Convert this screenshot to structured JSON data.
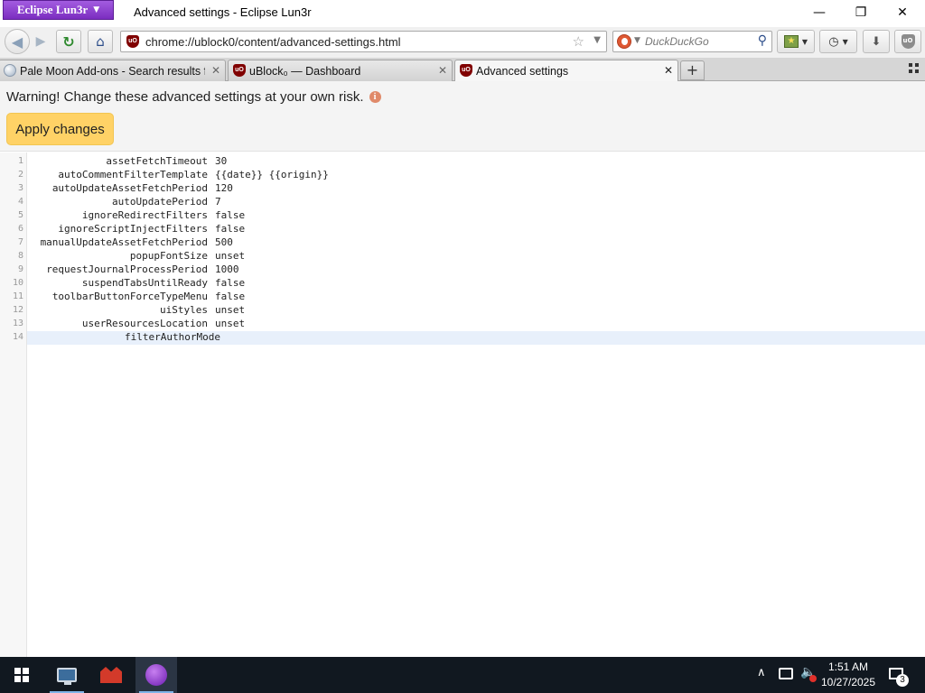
{
  "window": {
    "app_menu_label": "Eclipse Lun3r",
    "title": "Advanced settings - Eclipse Lun3r",
    "controls": [
      "—",
      "❐",
      "✕"
    ]
  },
  "navbar": {
    "url": "chrome://ublock0/content/advanced-settings.html",
    "search_placeholder": "DuckDuckGo"
  },
  "tabs": [
    {
      "label": "Pale Moon Add-ons - Search results for",
      "icon": "moon-icon",
      "active": false
    },
    {
      "label": "uBlock₀ — Dashboard",
      "icon": "ublock-icon",
      "active": false
    },
    {
      "label": "Advanced settings",
      "icon": "ublock-icon",
      "active": true
    }
  ],
  "page": {
    "warning": "Warning! Change these advanced settings at your own risk.",
    "apply_label": "Apply changes",
    "settings": [
      {
        "line": "1",
        "key": "assetFetchTimeout",
        "value": "30"
      },
      {
        "line": "2",
        "key": "autoCommentFilterTemplate",
        "value": "{{date}} {{origin}}"
      },
      {
        "line": "3",
        "key": "autoUpdateAssetFetchPeriod",
        "value": "120"
      },
      {
        "line": "4",
        "key": "autoUpdatePeriod",
        "value": "7"
      },
      {
        "line": "5",
        "key": "ignoreRedirectFilters",
        "value": "false"
      },
      {
        "line": "6",
        "key": "ignoreScriptInjectFilters",
        "value": "false"
      },
      {
        "line": "7",
        "key": "manualUpdateAssetFetchPeriod",
        "value": "500"
      },
      {
        "line": "8",
        "key": "popupFontSize",
        "value": "unset"
      },
      {
        "line": "9",
        "key": "requestJournalProcessPeriod",
        "value": "1000"
      },
      {
        "line": "10",
        "key": "suspendTabsUntilReady",
        "value": "false"
      },
      {
        "line": "11",
        "key": "toolbarButtonForceTypeMenu",
        "value": "false"
      },
      {
        "line": "12",
        "key": "uiStyles",
        "value": "unset"
      },
      {
        "line": "13",
        "key": "userResourcesLocation",
        "value": "unset"
      },
      {
        "line": "14",
        "key": "filterAuthorMode",
        "value": ""
      }
    ]
  },
  "taskbar": {
    "time": "1:51 AM",
    "date": "10/27/2025",
    "notification_count": "3"
  },
  "colors": {
    "apply_button": "#ffd266",
    "ublock_red": "#800000",
    "app_menu_purple": "#7b2dc0",
    "taskbar": "#111820"
  }
}
